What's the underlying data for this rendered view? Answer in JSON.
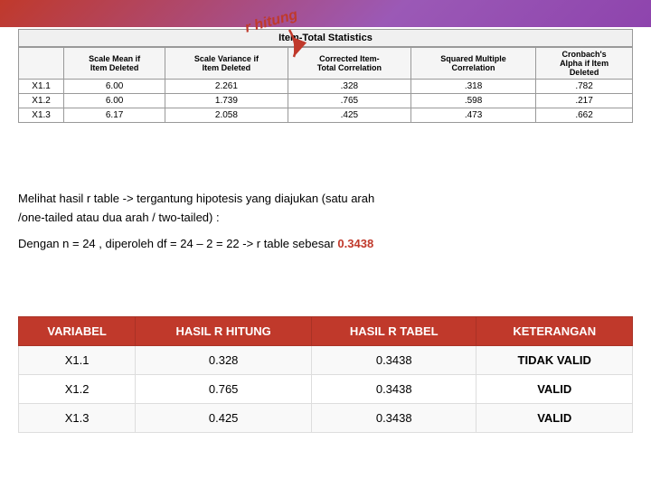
{
  "top_bg": {
    "color": "#c0392b"
  },
  "annotation": {
    "text": "r hitung",
    "arrow": "↓"
  },
  "stats_section": {
    "title": "Item-Total Statistics",
    "headers_row1": [
      {
        "label": "",
        "span": 1
      },
      {
        "label": "Scale Mean if Item Deleted",
        "span": 1
      },
      {
        "label": "Scale Variance if Item Deleted",
        "span": 1
      },
      {
        "label": "Corrected Item-Total Correlation",
        "span": 1
      },
      {
        "label": "Squared Multiple Correlation",
        "span": 1
      },
      {
        "label": "Cronbach's Alpha if Item Deleted",
        "span": 1
      }
    ],
    "rows": [
      {
        "item": "X1.1",
        "mean": "6.00",
        "variance": "2.261",
        "corr": ".328",
        "sq_mult": ".318",
        "alpha": ".782"
      },
      {
        "item": "X1.2",
        "mean": "6.00",
        "variance": "1.739",
        "corr": ".765",
        "sq_mult": ".598",
        "alpha": ".217"
      },
      {
        "item": "X1.3",
        "mean": "6.17",
        "variance": "2.058",
        "corr": ".425",
        "sq_mult": ".473",
        "alpha": ".662"
      }
    ]
  },
  "description": {
    "line1": "Melihat hasil r table -> tergantung hipotesis yang diajukan (satu arah",
    "line2": "/one-tailed atau dua arah / two-tailed) :",
    "line3_prefix": "Dengan n = 24 , diperoleh df = 24 – 2 = 22 -> r table sebesar ",
    "r_table_value": "0.3438"
  },
  "results_table": {
    "headers": [
      "VARIABEL",
      "HASIL R HITUNG",
      "HASIL R TABEL",
      "KETERANGAN"
    ],
    "rows": [
      {
        "variabel": "X1.1",
        "r_hitung": "0.328",
        "r_tabel": "0.3438",
        "keterangan": "TIDAK VALID"
      },
      {
        "variabel": "X1.2",
        "r_hitung": "0.765",
        "r_tabel": "0.3438",
        "keterangan": "VALID"
      },
      {
        "variabel": "X1.3",
        "r_hitung": "0.425",
        "r_tabel": "0.3438",
        "keterangan": "VALID"
      }
    ]
  }
}
